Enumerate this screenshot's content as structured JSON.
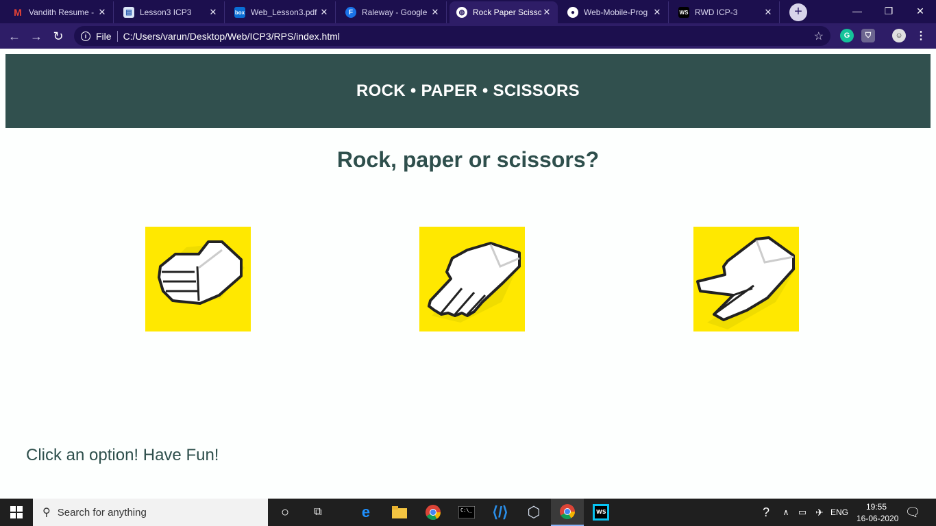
{
  "browser": {
    "tabs": [
      {
        "title": "Vandith Resume -",
        "favicon": "gmail-icon",
        "active": false
      },
      {
        "title": "Lesson3 ICP3",
        "favicon": "document-icon",
        "active": false
      },
      {
        "title": "Web_Lesson3.pdf |",
        "favicon": "box-icon",
        "active": false
      },
      {
        "title": "Raleway - Google",
        "favicon": "google-fonts-icon",
        "active": false
      },
      {
        "title": "Rock Paper Scissor",
        "favicon": "globe-icon",
        "active": true
      },
      {
        "title": "Web-Mobile-Prog",
        "favicon": "github-icon",
        "active": false
      },
      {
        "title": "RWD ICP-3",
        "favicon": "webstorm-icon",
        "active": false
      }
    ],
    "address": {
      "scheme_label": "File",
      "url": "C:/Users/varun/Desktop/Web/ICP3/RPS/index.html"
    }
  },
  "page": {
    "banner_title": "ROCK • PAPER • SCISSORS",
    "question": "Rock, paper or scissors?",
    "choices": [
      {
        "name": "rock",
        "icon": "rock-hand-icon"
      },
      {
        "name": "paper",
        "icon": "paper-hand-icon"
      },
      {
        "name": "scissors",
        "icon": "scissors-hand-icon"
      }
    ],
    "message": "Click an option! Have Fun!"
  },
  "taskbar": {
    "search_placeholder": "Search for anything",
    "language": "ENG",
    "time": "19:55",
    "date": "16-06-2020"
  },
  "colors": {
    "banner_bg": "#31504e",
    "text_dark": "#2e4f4c",
    "choice_bg": "#ffe800",
    "chrome_dark": "#1c0f4e",
    "chrome_toolbar": "#2e1d67"
  }
}
